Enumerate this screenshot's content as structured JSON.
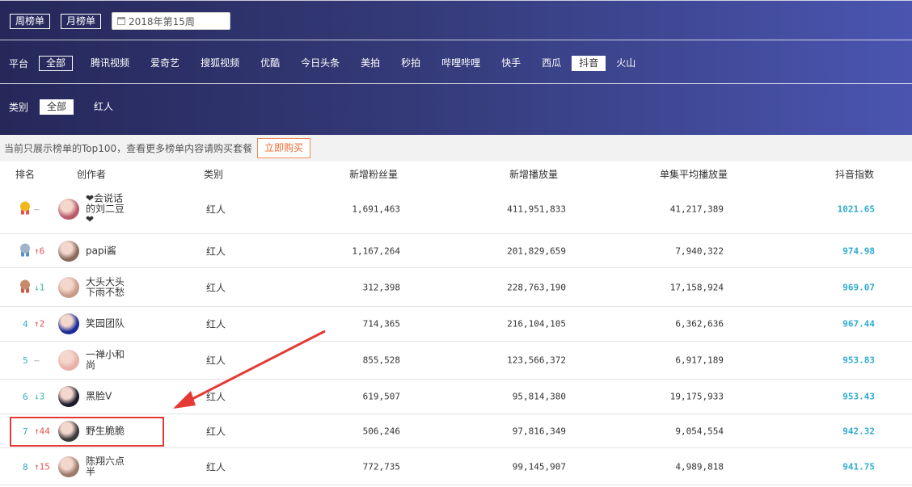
{
  "header": {
    "weekly_label": "周榜单",
    "monthly_label": "月榜单",
    "date_value": "2018年第15周",
    "platform_label": "平台",
    "platforms": [
      {
        "label": "全部",
        "state": "outlined"
      },
      {
        "label": "腾讯视频",
        "state": "normal"
      },
      {
        "label": "爱奇艺",
        "state": "normal"
      },
      {
        "label": "搜狐视频",
        "state": "normal"
      },
      {
        "label": "优酷",
        "state": "normal"
      },
      {
        "label": "今日头条",
        "state": "normal"
      },
      {
        "label": "美拍",
        "state": "normal"
      },
      {
        "label": "秒拍",
        "state": "normal"
      },
      {
        "label": "哔哩哔哩",
        "state": "normal"
      },
      {
        "label": "快手",
        "state": "normal"
      },
      {
        "label": "西瓜",
        "state": "normal"
      },
      {
        "label": "抖音",
        "state": "filled"
      },
      {
        "label": "火山",
        "state": "normal"
      }
    ],
    "category_label": "类别",
    "categories": [
      {
        "label": "全部",
        "state": "filled"
      },
      {
        "label": "红人",
        "state": "normal"
      }
    ]
  },
  "notice": {
    "text": "当前只展示榜单的Top100，查看更多榜单内容请购买套餐",
    "buy_label": "立即购买"
  },
  "table": {
    "columns": [
      "排名",
      "创作者",
      "类别",
      "新增粉丝量",
      "新增播放量",
      "单集平均播放量",
      "抖音指数"
    ],
    "rows": [
      {
        "rank": "",
        "medal": "gold",
        "change": "–",
        "dir": "flat",
        "creator": "❤会说话的刘二豆❤",
        "category": "红人",
        "fans": "1,691,463",
        "plays": "411,951,833",
        "avg": "41,217,389",
        "index": "1021.65",
        "avatar": "#b85a6a"
      },
      {
        "rank": "",
        "medal": "silver",
        "change": "↑6",
        "dir": "up",
        "creator": "papi酱",
        "category": "红人",
        "fans": "1,167,264",
        "plays": "201,829,659",
        "avg": "7,940,322",
        "index": "974.98",
        "avatar": "#8a6a5a"
      },
      {
        "rank": "",
        "medal": "bronze",
        "change": "↓1",
        "dir": "down",
        "creator": "大头大头下雨不愁",
        "category": "红人",
        "fans": "312,398",
        "plays": "228,763,190",
        "avg": "17,158,924",
        "index": "969.07",
        "avatar": "#c89a8a"
      },
      {
        "rank": "4",
        "medal": "",
        "change": "↑2",
        "dir": "up",
        "creator": "笑园团队",
        "category": "红人",
        "fans": "714,365",
        "plays": "216,104,105",
        "avg": "6,362,636",
        "index": "967.44",
        "avatar": "#1a2a9a"
      },
      {
        "rank": "5",
        "medal": "",
        "change": "–",
        "dir": "flat",
        "creator": "一禅小和尚",
        "category": "红人",
        "fans": "855,528",
        "plays": "123,566,372",
        "avg": "6,917,189",
        "index": "953.83",
        "avatar": "#e8b0a8"
      },
      {
        "rank": "6",
        "medal": "",
        "change": "↓3",
        "dir": "down",
        "creator": "黑脸V",
        "category": "红人",
        "fans": "619,507",
        "plays": "95,814,380",
        "avg": "19,175,933",
        "index": "953.43",
        "avatar": "#1a1a2a"
      },
      {
        "rank": "7",
        "medal": "",
        "change": "↑44",
        "dir": "up",
        "creator": "野生脆脆",
        "category": "红人",
        "fans": "506,246",
        "plays": "97,816,349",
        "avg": "9,054,554",
        "index": "942.32",
        "avatar": "#3a3a3a"
      },
      {
        "rank": "8",
        "medal": "",
        "change": "↑15",
        "dir": "up",
        "creator": "陈翔六点半",
        "category": "红人",
        "fans": "772,735",
        "plays": "99,145,907",
        "avg": "4,989,818",
        "index": "941.75",
        "avatar": "#9a7a6a"
      }
    ]
  },
  "colors": {
    "accent": "#2eabd0",
    "up": "#e8534f",
    "down": "#3bb7a0",
    "highlight": "#e53935"
  }
}
